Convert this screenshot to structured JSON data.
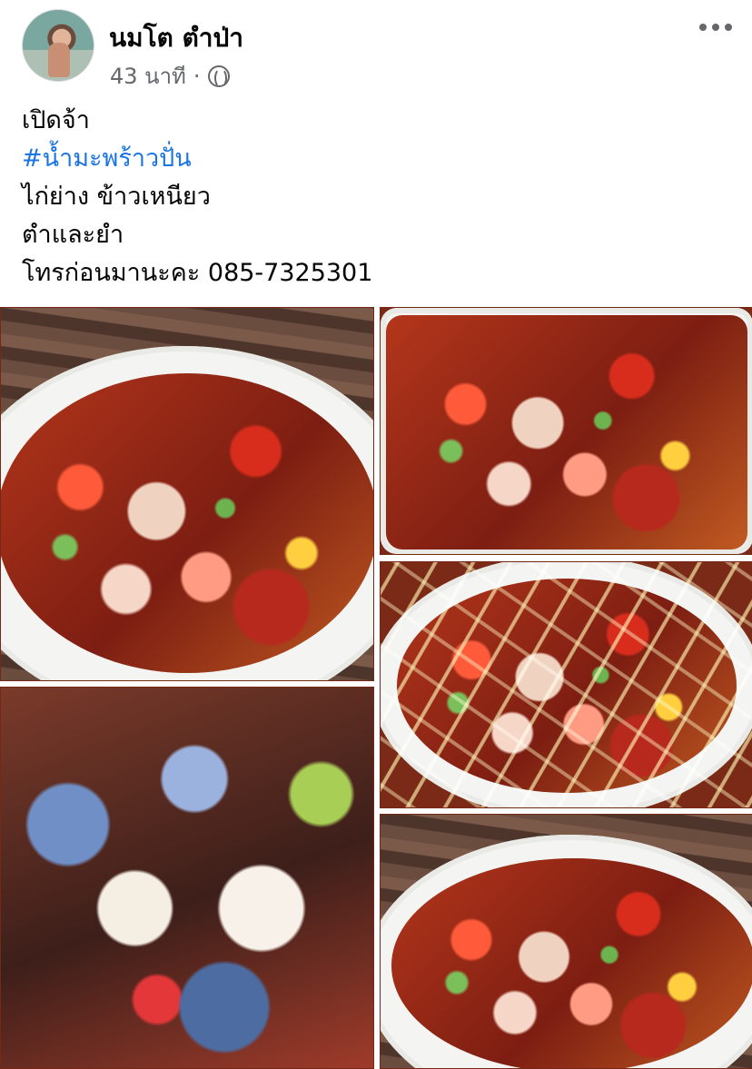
{
  "post": {
    "author": "นมโต ตำป่า",
    "time": "43 นาที",
    "separator": "·",
    "privacy_icon": "globe-icon",
    "more_icon": "more-options-icon",
    "text_lines": [
      "เปิดจ้า",
      "#น้ำมะพร้าวปั่น",
      "ไก่ย่าง ข้าวเหนียว",
      "ตำและยำ",
      "โทรก่อนมานะคะ 085-7325301"
    ]
  },
  "colors": {
    "hashtag": "#1b74e4",
    "meta": "#65676b",
    "text": "#050505"
  }
}
